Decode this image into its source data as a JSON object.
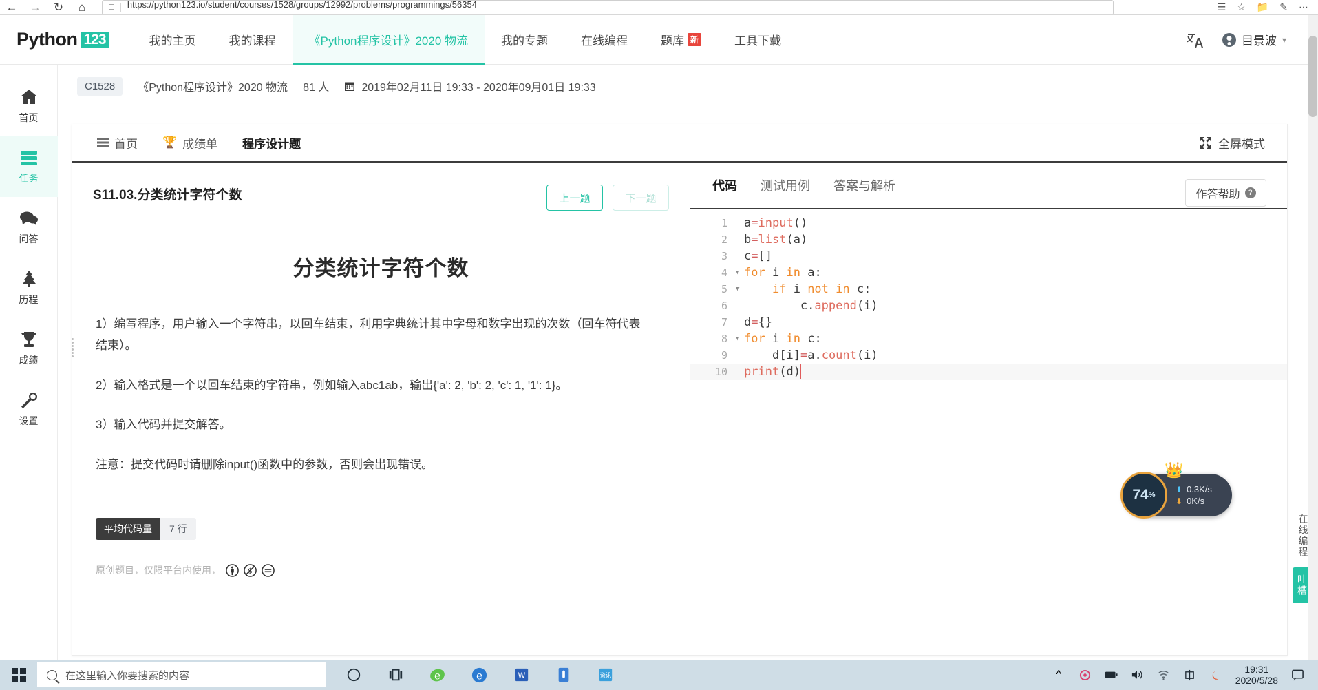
{
  "browser": {
    "url": "https://python123.io/student/courses/1528/groups/12992/problems/programmings/56354",
    "back_icon": "back-arrow-icon",
    "forward_icon": "forward-arrow-icon",
    "reload_icon": "reload-icon",
    "home_icon": "home-icon",
    "reader_icon": "reader-view-icon",
    "favorite_icon": "star-icon",
    "collections_icon": "collections-icon",
    "annotate_icon": "annotate-icon",
    "menu_icon": "more-menu-icon"
  },
  "topnav": {
    "brand_text": "Python",
    "brand_badge": "123",
    "items": [
      {
        "label": "我的主页",
        "active": false
      },
      {
        "label": "我的课程",
        "active": false
      },
      {
        "label": "《Python程序设计》2020 物流",
        "active": true
      },
      {
        "label": "我的专题",
        "active": false
      },
      {
        "label": "在线编程",
        "active": false
      },
      {
        "label": "题库",
        "active": false,
        "badge": "新"
      },
      {
        "label": "工具下载",
        "active": false
      }
    ],
    "translate_icon": "translate-icon",
    "user_name": "目景波",
    "user_avatar_icon": "avatar-icon",
    "user_caret_icon": "chevron-down-icon",
    "accent_color": "#24c3a5"
  },
  "rail": {
    "items": [
      {
        "label": "首页",
        "icon": "home-icon",
        "active": false
      },
      {
        "label": "任务",
        "icon": "tasks-icon",
        "active": true
      },
      {
        "label": "问答",
        "icon": "chat-bubbles-icon",
        "active": false
      },
      {
        "label": "历程",
        "icon": "tree-icon",
        "active": false
      },
      {
        "label": "成绩",
        "icon": "trophy-icon",
        "active": false
      },
      {
        "label": "设置",
        "icon": "wrench-icon",
        "active": false
      }
    ]
  },
  "breadcrumb": {
    "course_code": "C1528",
    "course_name": "《Python程序设计》2020 物流",
    "members": "81 人",
    "calendar_icon": "calendar-icon",
    "date_range": "2019年02月11日 19:33 - 2020年09月01日 19:33"
  },
  "card_tabs": {
    "items": [
      {
        "label": "首页",
        "icon": "list-icon",
        "active": false
      },
      {
        "label": "成绩单",
        "icon": "trophy-icon",
        "active": false
      },
      {
        "label": "程序设计题",
        "icon": "",
        "active": true
      }
    ],
    "fullscreen_label": "全屏模式",
    "fullscreen_icon": "fullscreen-icon"
  },
  "problem": {
    "id_label": "S11.03.分类统计字符个数",
    "prev_button": "上一题",
    "next_button": "下一题",
    "next_disabled": true,
    "title": "分类统计字符个数",
    "lines": [
      "1）编写程序，用户输入一个字符串，以回车结束，利用字典统计其中字母和数字出现的次数（回车符代表结束）。",
      "2）输入格式是一个以回车结束的字符串，例如输入abc1ab，输出{'a': 2, 'b': 2, 'c': 1, '1': 1}。",
      "3）输入代码并提交解答。",
      "注意：提交代码时请删除input()函数中的参数，否则会出现错误。"
    ],
    "meta_key": "平均代码量",
    "meta_value": "7 行",
    "copyright_text": "原创题目，仅限平台内使用，",
    "license_icons": [
      "cc-by-icon",
      "cc-nc-icon",
      "cc-nd-icon"
    ],
    "drag_handle_icon": "drag-handle-icon"
  },
  "editor": {
    "tabs": [
      {
        "label": "代码",
        "active": true
      },
      {
        "label": "测试用例",
        "active": false
      },
      {
        "label": "答案与解析",
        "active": false
      }
    ],
    "help_label": "作答帮助",
    "help_icon": "question-mark-icon",
    "lines": [
      {
        "n": "1",
        "fold": false,
        "code": "a=input()"
      },
      {
        "n": "2",
        "fold": false,
        "code": "b=list(a)"
      },
      {
        "n": "3",
        "fold": false,
        "code": "c=[]"
      },
      {
        "n": "4",
        "fold": true,
        "code": "for i in a:"
      },
      {
        "n": "5",
        "fold": true,
        "code": "    if i not in c:"
      },
      {
        "n": "6",
        "fold": false,
        "code": "        c.append(i)"
      },
      {
        "n": "7",
        "fold": false,
        "code": "d={}"
      },
      {
        "n": "8",
        "fold": true,
        "code": "for i in c:"
      },
      {
        "n": "9",
        "fold": false,
        "code": "    d[i]=a.count(i)"
      },
      {
        "n": "10",
        "fold": false,
        "code": "print(d)",
        "current": true
      }
    ]
  },
  "speed_widget": {
    "percent": "74",
    "percent_symbol": "%",
    "upload": "0.3K/s",
    "download": "0K/s",
    "upload_icon": "arrow-up-icon",
    "download_icon": "arrow-down-icon",
    "crown_icon": "crown-icon"
  },
  "edge": {
    "vertical_label": "在线编程",
    "feedback_label": "吐槽"
  },
  "taskbar": {
    "start_icon": "windows-start-icon",
    "search_placeholder": "在这里输入你要搜索的内容",
    "search_icon": "search-icon",
    "pinned": [
      {
        "icon": "cortana-icon",
        "label": "O"
      },
      {
        "icon": "task-view-icon",
        "label": ""
      },
      {
        "icon": "ie-classic-icon",
        "label": "e"
      },
      {
        "icon": "edge-icon",
        "label": "e"
      },
      {
        "icon": "word-icon",
        "label": "W"
      },
      {
        "icon": "reader-icon",
        "label": ""
      },
      {
        "icon": "news-icon",
        "label": "资讯"
      }
    ],
    "tray": [
      {
        "icon": "chevron-up-icon"
      },
      {
        "icon": "security-icon"
      },
      {
        "icon": "battery-icon"
      },
      {
        "icon": "volume-icon"
      },
      {
        "icon": "wifi-icon"
      },
      {
        "icon": "ime-chinese-icon"
      },
      {
        "icon": "sogou-icon"
      }
    ],
    "clock_time": "19:31",
    "clock_date": "2020/5/28",
    "notification_icon": "notification-icon"
  }
}
